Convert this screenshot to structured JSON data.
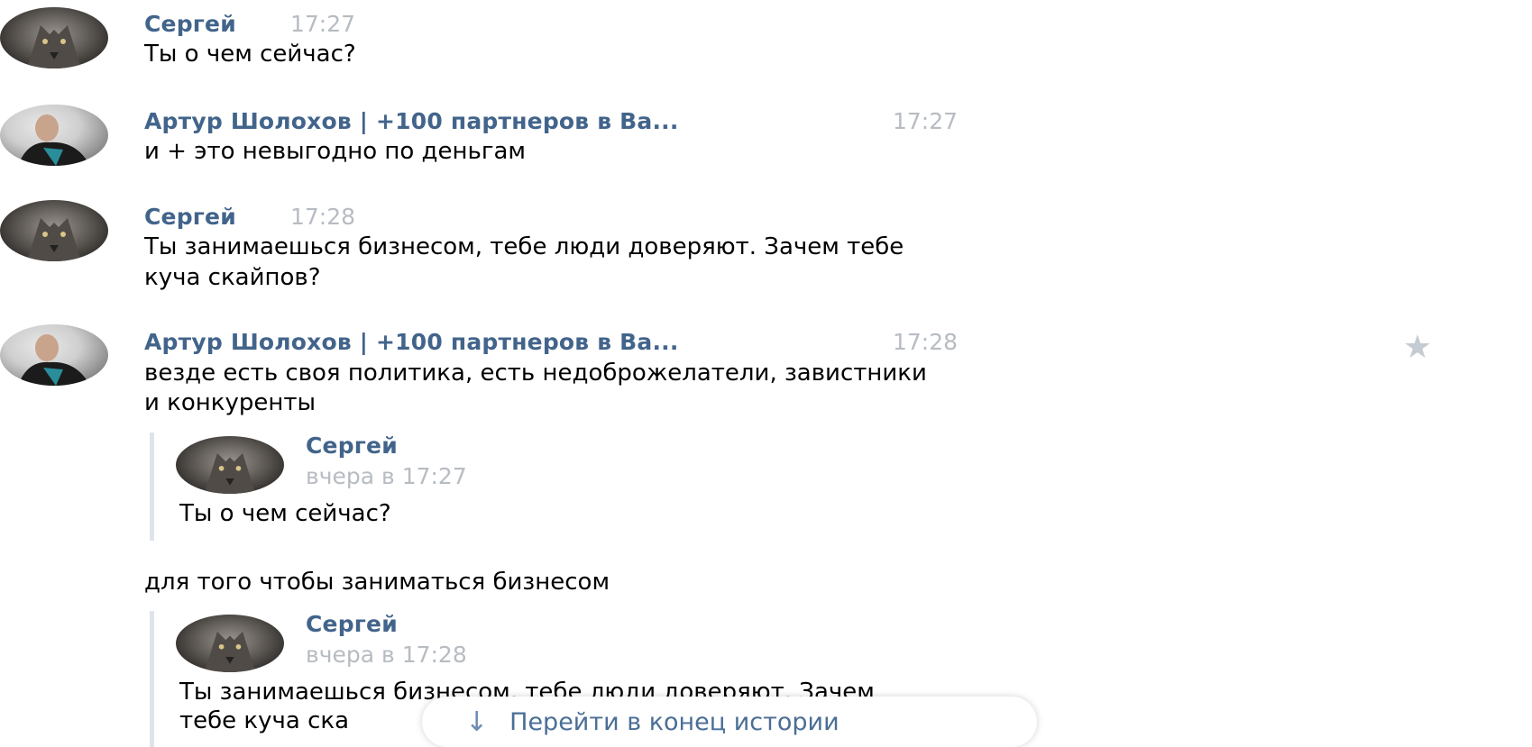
{
  "messages": [
    {
      "author": "Сергей",
      "time": "17:27",
      "lines": [
        "Ты о чем сейчас?"
      ],
      "avatar": "wolf-avatar"
    },
    {
      "author": "Артур Шолохов | +100 партнеров в Ва...",
      "time": "17:27",
      "lines": [
        "и + это невыгодно по деньгам"
      ],
      "avatar": "man-avatar"
    },
    {
      "author": "Сергей",
      "time": "17:28",
      "lines": [
        "Ты занимаешься бизнесом, тебе люди доверяют. Зачем тебе",
        "куча скайпов?"
      ],
      "avatar": "wolf-avatar"
    },
    {
      "author": "Артур Шолохов | +100 партнеров в Ва...",
      "time": "17:28",
      "lines": [
        "везде есть своя политика, есть недоброжелатели, завистники",
        "и конкуренты"
      ],
      "avatar": "man-avatar"
    }
  ],
  "quote1": {
    "author": "Сергей",
    "date": "вчера в 17:27",
    "text": "Ты о чем сейчас?"
  },
  "followup": "для того чтобы заниматься бизнесом",
  "quote2": {
    "author": "Сергей",
    "date": "вчера в 17:28",
    "line1": "Ты занимаешься бизнесом, тебе люди доверяют. Зачем",
    "line2": "тебе куча ска"
  },
  "jump_button": {
    "label": "Перейти в конец истории",
    "icon": "arrow-down-icon"
  },
  "star_icon": "star-icon",
  "colors": {
    "author": "#42648b",
    "time": "#b7bcc2",
    "quote_border": "#dfe4ea",
    "link": "#4a6e96"
  }
}
